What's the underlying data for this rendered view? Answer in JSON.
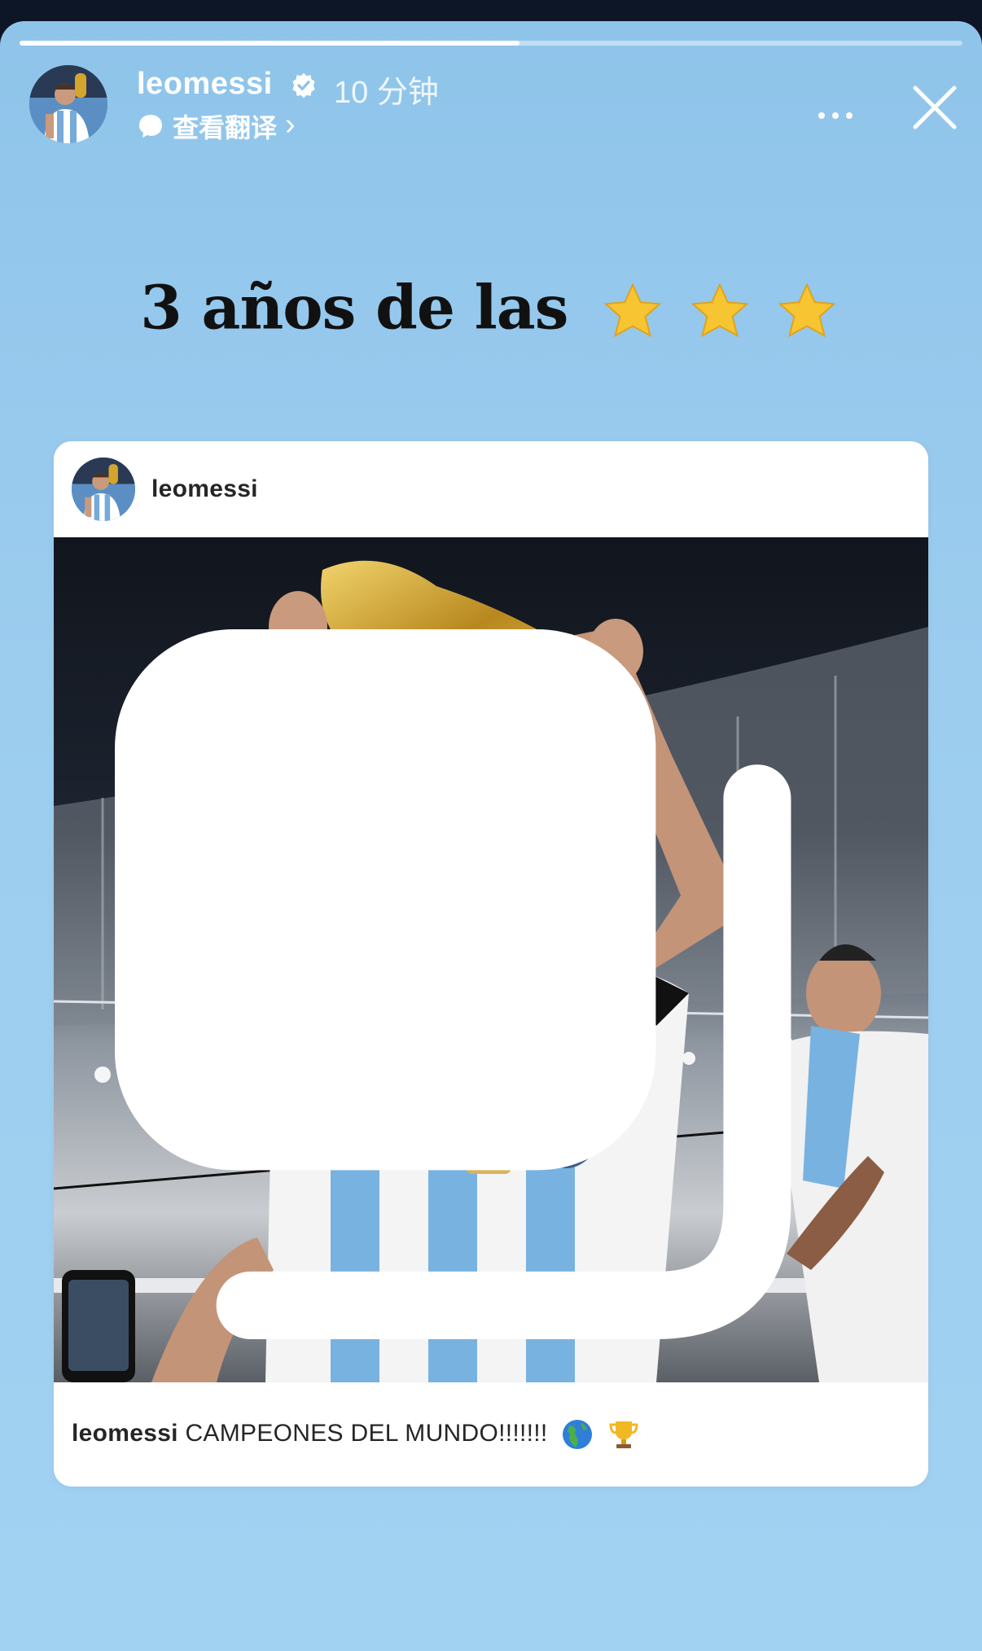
{
  "story": {
    "progress": 0.53,
    "username": "leomessi",
    "verified": true,
    "time_ago": "10 分钟",
    "translate_label": "查看翻译",
    "translate_chevron": "›",
    "more_icon": "more-horizontal-icon",
    "close_icon": "close-icon",
    "headline": "3 años de las",
    "headline_emoji": [
      "star",
      "star",
      "star"
    ]
  },
  "post": {
    "username": "leomessi",
    "media_icon": "carousel-icon",
    "photo_description_icon": "photo",
    "caption_user": "leomessi",
    "caption_text": "CAMPEONES DEL MUNDO!!!!!!!",
    "caption_emoji": [
      "globe-americas",
      "trophy"
    ]
  },
  "colors": {
    "background_top": "#8fc4ea",
    "background_bottom": "#a2d2f2",
    "card": "#ffffff",
    "text_dark": "#262626",
    "star": "#f6c531",
    "verified": "#ffffff"
  }
}
